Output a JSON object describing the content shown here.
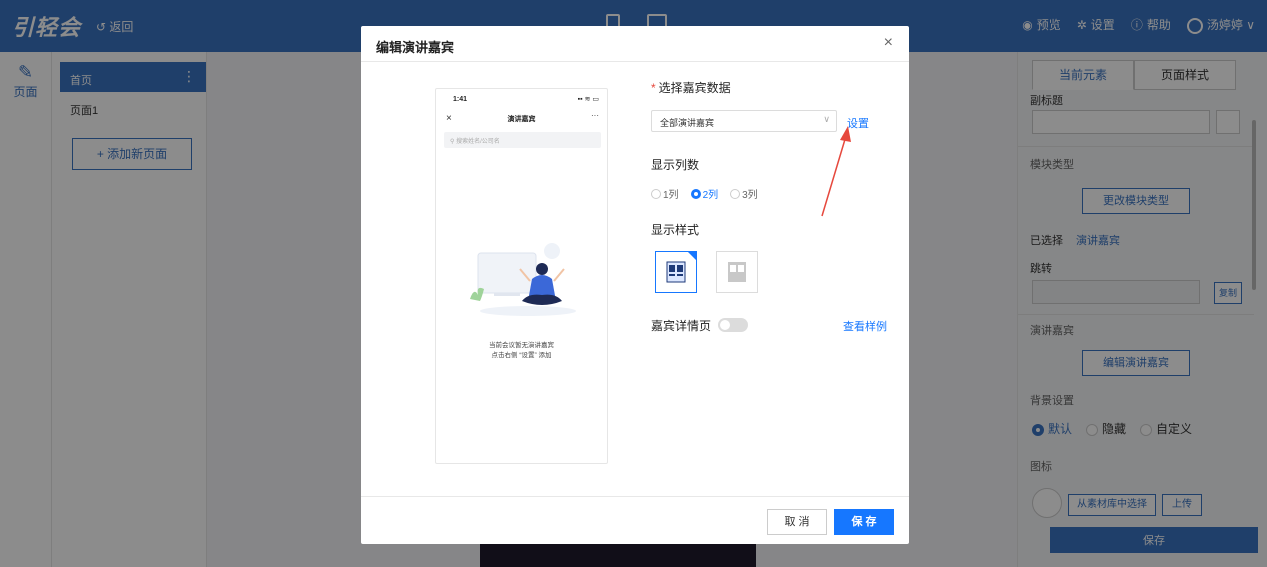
{
  "topbar": {
    "logo": "引轻会",
    "back": "返回",
    "preview": "预览",
    "settings": "设置",
    "help": "帮助",
    "user": "汤婷婷"
  },
  "tools": {
    "page_label": "页面"
  },
  "pages": {
    "active": "首页",
    "items": [
      "页面1"
    ],
    "add_label": "+ 添加新页面"
  },
  "right_panel": {
    "tab_current": "当前元素",
    "tab_page_style": "页面样式",
    "subtitle_label": "副标题",
    "module_type_label": "模块类型",
    "change_module_btn": "更改模块类型",
    "selected_label": "已选择",
    "selected_value": "演讲嘉宾",
    "jump_label": "跳转",
    "copy_btn": "复制",
    "speaker_label": "演讲嘉宾",
    "edit_speaker_btn": "编辑演讲嘉宾",
    "bg_label": "背景设置",
    "bg_options": [
      "默认",
      "隐藏",
      "自定义"
    ],
    "icon_label": "图标",
    "choose_lib_btn": "从素材库中选择",
    "upload_btn": "上传",
    "save_btn": "保存"
  },
  "modal": {
    "title": "编辑演讲嘉宾",
    "close": "×",
    "phone": {
      "time": "1:41",
      "status_right": "▪▪ ≋ ▭",
      "close": "×",
      "title": "演讲嘉宾",
      "more": "···",
      "search_placeholder": "搜索姓名/公司名",
      "empty_line1": "当前会议暂无演讲嘉宾",
      "empty_line2": "点击右侧 “设置” 添加"
    },
    "select_data_label": "选择嘉宾数据",
    "select_value": "全部演讲嘉宾",
    "setting_link": "设置",
    "columns_label": "显示列数",
    "columns_options": [
      "1列",
      "2列",
      "3列"
    ],
    "columns_selected": "2列",
    "style_label": "显示样式",
    "detail_label": "嘉宾详情页",
    "view_example": "查看样例",
    "cancel": "取 消",
    "save": "保 存"
  },
  "colors": {
    "brand": "#3a73c2",
    "primary": "#1677ff",
    "arrow": "#e6483d"
  }
}
